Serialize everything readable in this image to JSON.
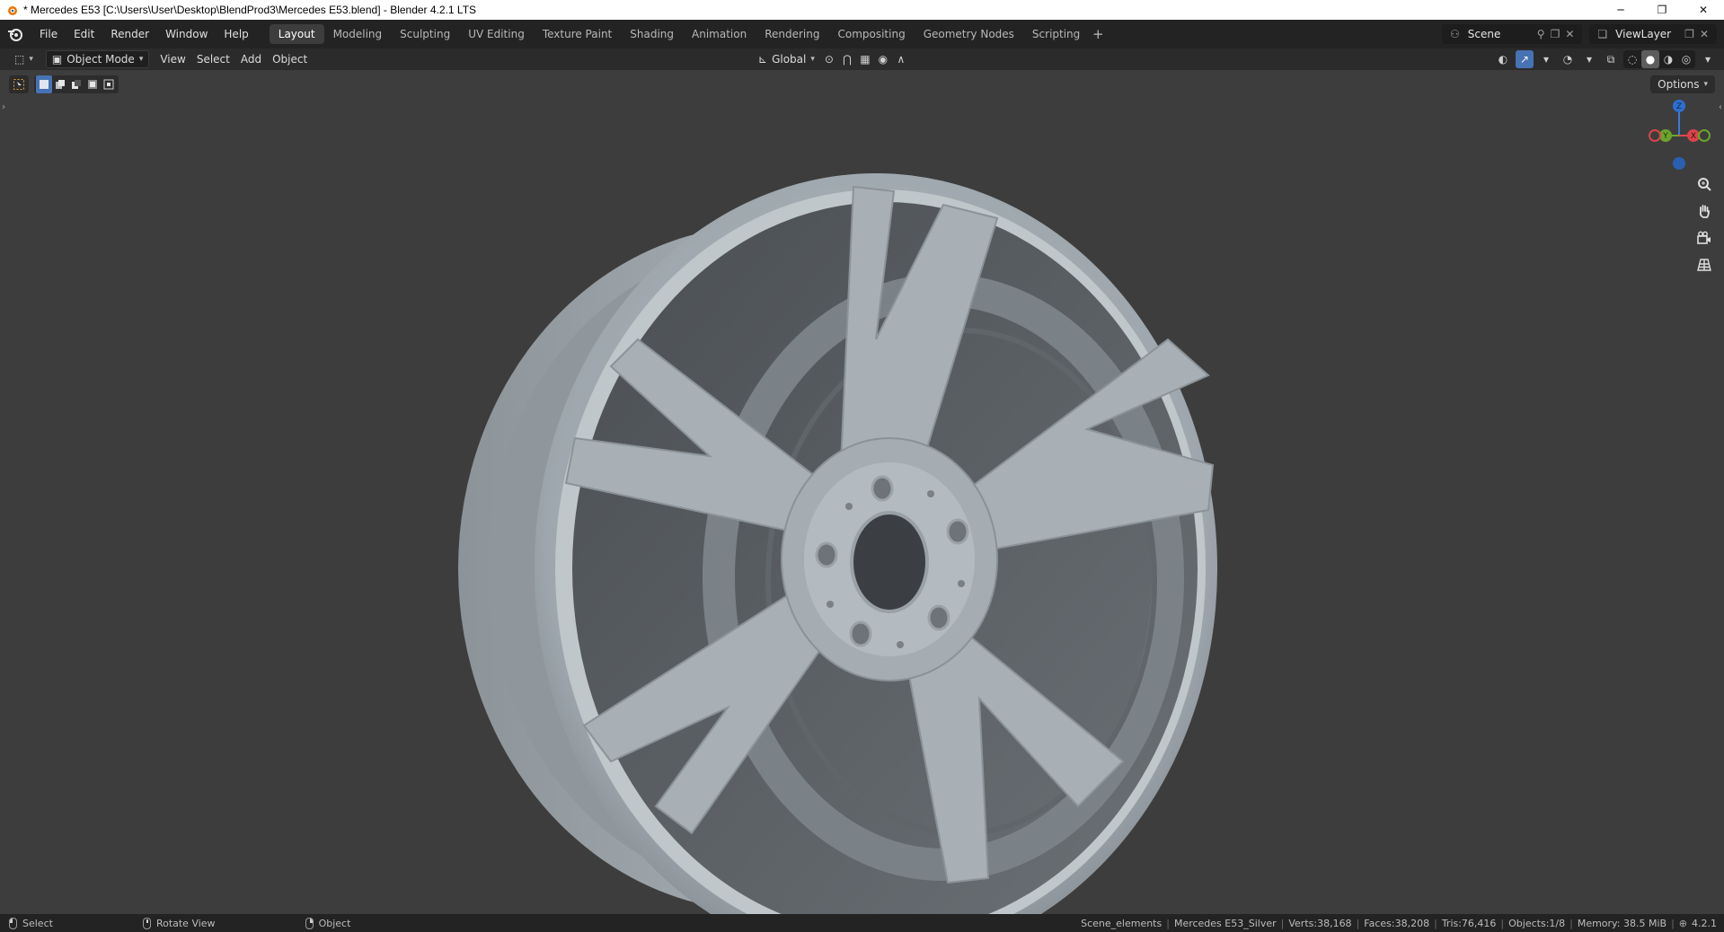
{
  "window": {
    "title": "* Mercedes E53 [C:\\Users\\User\\Desktop\\BlendProd3\\Mercedes E53.blend] - Blender 4.2.1 LTS",
    "minimize": "─",
    "restore": "❐",
    "close": "✕"
  },
  "menu": [
    "File",
    "Edit",
    "Render",
    "Window",
    "Help"
  ],
  "workspaces": [
    "Layout",
    "Modeling",
    "Sculpting",
    "UV Editing",
    "Texture Paint",
    "Shading",
    "Animation",
    "Rendering",
    "Compositing",
    "Geometry Nodes",
    "Scripting"
  ],
  "active_workspace": "Layout",
  "scene": {
    "name": "Scene",
    "view_layer": "ViewLayer"
  },
  "viewport_header": {
    "mode": "Object Mode",
    "menus": [
      "View",
      "Select",
      "Add",
      "Object"
    ],
    "transform_orientation": "Global",
    "options_label": "Options"
  },
  "gizmo": {
    "z": "Z",
    "y": "Y",
    "x": "X"
  },
  "statusbar": {
    "hints": [
      "Select",
      "Rotate View",
      "Object"
    ],
    "collection": "Scene_elements",
    "active_object": "Mercedes E53_Silver",
    "verts": "Verts:38,168",
    "faces": "Faces:38,208",
    "tris": "Tris:76,416",
    "objects": "Objects:1/8",
    "memory": "Memory: 38.5 MiB",
    "version": "4.2.1"
  },
  "colors": {
    "accent": "#4772b3",
    "wheel": "#a9b1b7",
    "background": "#3d3d3d"
  }
}
